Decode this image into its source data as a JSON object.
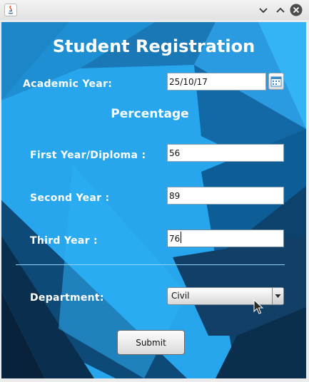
{
  "window": {
    "app_icon": "java-icon",
    "controls": [
      "minimize-icon",
      "maximize-icon",
      "close-icon"
    ]
  },
  "form": {
    "title": "Student Registration",
    "academic_year": {
      "label": "Academic Year:",
      "value": "25/10/17",
      "picker_icon": "calendar-icon"
    },
    "percentage_heading": "Percentage",
    "first_year": {
      "label": "First Year/Diploma :",
      "value": "56"
    },
    "second_year": {
      "label": "Second Year :",
      "value": "89"
    },
    "third_year": {
      "label": "Third Year :",
      "value": "76"
    },
    "department": {
      "label": "Department:",
      "selected": "Civil"
    },
    "submit_label": "Submit"
  },
  "colors": {
    "background_blue": "#2aa8ee",
    "dark_navy": "#0b2e4a",
    "mid_blue": "#1a79b8",
    "text_white": "#ffffff"
  }
}
